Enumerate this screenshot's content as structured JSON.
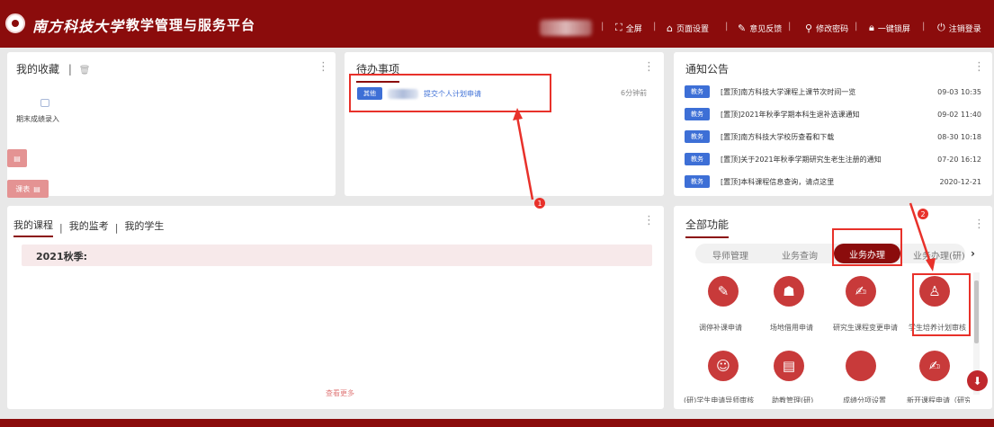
{
  "header": {
    "logo_text": "南方科技大学",
    "system_title": "教学管理与服务平台",
    "nav": [
      {
        "icon": "fullscreen-icon",
        "label": "全屏"
      },
      {
        "icon": "home-settings-icon",
        "label": "页面设置"
      },
      {
        "icon": "feedback-icon",
        "label": "意见反馈"
      },
      {
        "icon": "key-icon",
        "label": "修改密码"
      },
      {
        "icon": "lock-icon",
        "label": "一键锁屏"
      },
      {
        "icon": "power-icon",
        "label": "注销登录"
      }
    ]
  },
  "favorites": {
    "title": "我的收藏",
    "items": [
      {
        "label": "期末成绩录入"
      }
    ]
  },
  "todo": {
    "title": "待办事项",
    "items": [
      {
        "tag": "其他",
        "text": "提交个人计划申请",
        "time": "6分钟前"
      }
    ]
  },
  "notices": {
    "title": "通知公告",
    "items": [
      {
        "tag": "教务",
        "text": "[置顶]南方科技大学课程上课节次时间一览",
        "time": "09-03 10:35"
      },
      {
        "tag": "教务",
        "text": "[置顶]2021年秋季学期本科生退补选课通知",
        "time": "09-02 11:40"
      },
      {
        "tag": "教务",
        "text": "[置顶]南方科技大学校历查看和下载",
        "time": "08-30 10:18"
      },
      {
        "tag": "教务",
        "text": "[置顶]关于2021年秋季学期研究生老生注册的通知",
        "time": "07-20 16:12"
      },
      {
        "tag": "教务",
        "text": "[置顶]本科课程信息查询，请点这里",
        "time": "2020-12-21"
      }
    ]
  },
  "side_floaters": {
    "schedule": "课表"
  },
  "courses": {
    "tabs": [
      "我的课程",
      "我的监考",
      "我的学生"
    ],
    "term": "2021秋季:",
    "more": "查看更多"
  },
  "functions": {
    "title": "全部功能",
    "categories": [
      "导师管理",
      "业务查询",
      "业务办理",
      "业务办理(研)"
    ],
    "items": [
      {
        "icon": "edit-icon",
        "label": "调停补课申请"
      },
      {
        "icon": "signpost-icon",
        "label": "场地借用申请"
      },
      {
        "icon": "document-edit-icon",
        "label": "研究生课程变更申请"
      },
      {
        "icon": "stamp-icon",
        "label": "学生培养计划审核"
      },
      {
        "icon": "user-badge-icon",
        "label": "(研)学生申请导师审核"
      },
      {
        "icon": "book-icon",
        "label": "助教管理(研)"
      },
      {
        "icon": "circle-icon",
        "label": "成绩分项设置"
      },
      {
        "icon": "document-edit-icon",
        "label": "新开课程申请（研究"
      }
    ]
  },
  "annotations": [
    "1",
    "2"
  ],
  "colors": {
    "brand": "#8b0c0c",
    "accent_blue": "#3d6fd6",
    "annotation_red": "#e8312a"
  }
}
